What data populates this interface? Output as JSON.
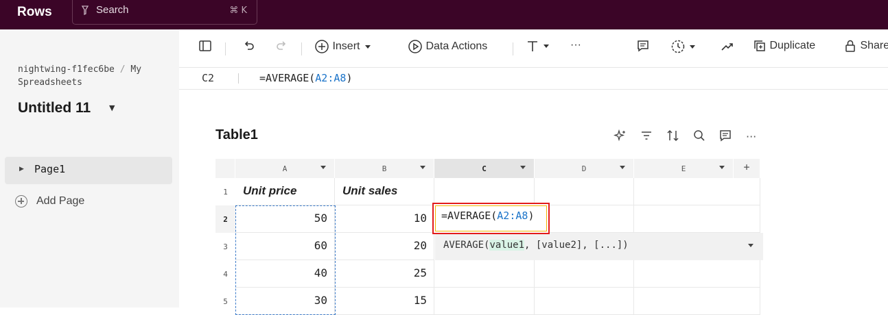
{
  "topbar": {
    "brand": "Rows",
    "search_label": "Search",
    "search_shortcut": "⌘ K"
  },
  "sidebar": {
    "breadcrumb_workspace": "nightwing-f1fec6be",
    "breadcrumb_separator": "/",
    "breadcrumb_folder": "My Spreadsheets",
    "doc_title": "Untitled 11",
    "pages": [
      {
        "label": "Page1"
      }
    ],
    "add_page_label": "Add Page"
  },
  "toolbar": {
    "insert_label": "Insert",
    "data_actions_label": "Data Actions",
    "more_label": "···",
    "duplicate_label": "Duplicate",
    "share_label": "Share"
  },
  "formula_bar": {
    "cell_ref": "C2",
    "formula_prefix": "=AVERAGE(",
    "formula_range": "A2:A8",
    "formula_suffix": ")"
  },
  "table": {
    "title": "Table1",
    "more_label": "···",
    "add_column_label": "+",
    "columns": [
      "A",
      "B",
      "C",
      "D",
      "E"
    ],
    "row_numbers": [
      "1",
      "2",
      "3",
      "4",
      "5"
    ],
    "headers": [
      "Unit price",
      "Unit sales"
    ],
    "rows": [
      [
        "50",
        "10"
      ],
      [
        "60",
        "20"
      ],
      [
        "40",
        "25"
      ],
      [
        "30",
        "15"
      ]
    ],
    "editing_cell": {
      "prefix": "=AVERAGE(",
      "range": "A2:A8",
      "suffix": ")"
    },
    "function_hint": {
      "name": "AVERAGE(",
      "active_arg": "value1",
      "rest": ", [value2], [...])"
    }
  },
  "colors": {
    "topbar": "#3b0527",
    "active_cell_border": "#e21b1b",
    "range_reference": "#1a73c9"
  }
}
